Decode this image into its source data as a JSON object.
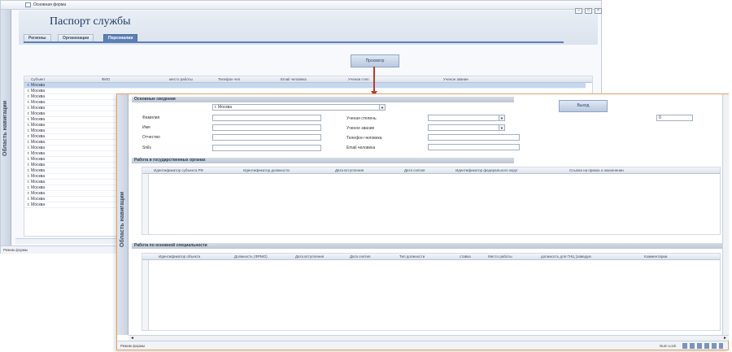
{
  "back_window": {
    "title": "Основная форма",
    "nav_pane_label": "Область навигации",
    "form_heading": "Паспорт службы",
    "tabs": [
      {
        "label": "Регионы"
      },
      {
        "label": "Организации"
      },
      {
        "label": "Персоналии"
      }
    ],
    "view_button": "Просмотр",
    "grid_columns": [
      "Субъект",
      "ФИО",
      "место работы",
      "Телефон чел",
      "Email человека",
      "Ученая степ",
      "Ученое звание"
    ],
    "rows": [
      "г. Москва",
      "г. Москва",
      "г. Москва",
      "г. Москва",
      "г. Москва",
      "г. Москва",
      "г. Москва",
      "г. Москва",
      "г. Москва",
      "г. Москва",
      "г. Москва",
      "г. Москва",
      "г. Москва",
      "г. Москва",
      "г. Москва",
      "г. Москва",
      "г. Москва",
      "г. Москва",
      "г. Москва",
      "г. Москва",
      "г. Москва",
      "г. Москва"
    ],
    "status": "Режим формы"
  },
  "front_window": {
    "nav_pane_label": "Область навигации",
    "section_main": "Основные сведения",
    "subject_value": "г. Москва",
    "labels": {
      "surname": "Фамилия",
      "name": "Имя",
      "patronymic": "Отчество",
      "snils": "Snils",
      "degree": "Ученая степень",
      "title": "Ученое звание",
      "phone": "Телефон человека",
      "email": "Email человека"
    },
    "exit_button": "Выход",
    "counter_value": "0",
    "section_gov": "Работа в государственных органах",
    "gov_columns": [
      "Идентификатор субъекта РФ",
      "Идентификатор должности",
      "Дата вступления",
      "Дата снятия",
      "Идентификатор федерального округ",
      "Ссылка на приказ о назначении"
    ],
    "section_spec": "Работа по основной специальности",
    "spec_columns": [
      "Идентификатор объекта",
      "Должность (ФРМО)",
      "Дата вступления",
      "Дата снятия",
      "Тип должности",
      "ставка",
      "Место работы",
      "должность для ГНЦ (заведую",
      "Комментарии"
    ],
    "status_left": "Режим формы",
    "status_right": "Num Lock"
  },
  "colors": {
    "accent": "#5b80b5",
    "pointer": "#c0392b",
    "frame": "#e8a060"
  }
}
